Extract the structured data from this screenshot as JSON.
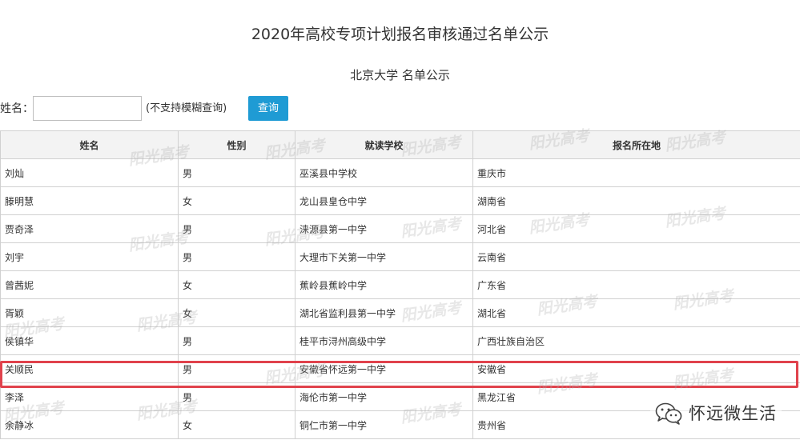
{
  "page": {
    "title": "2020年高校专项计划报名审核通过名单公示",
    "subtitle": "北京大学 名单公示"
  },
  "search": {
    "label": "姓名：",
    "value": "",
    "placeholder": "",
    "note": "(不支持模糊查询)",
    "button_label": "查询"
  },
  "table": {
    "headers": [
      "姓名",
      "性别",
      "就读学校",
      "报名所在地"
    ],
    "rows": [
      [
        "刘灿",
        "男",
        "巫溪县中学校",
        "重庆市"
      ],
      [
        "滕明慧",
        "女",
        "龙山县皇仓中学",
        "湖南省"
      ],
      [
        "贾奇泽",
        "男",
        "涞源县第一中学",
        "河北省"
      ],
      [
        "刘宇",
        "男",
        "大理市下关第一中学",
        "云南省"
      ],
      [
        "曾茜妮",
        "女",
        "蕉岭县蕉岭中学",
        "广东省"
      ],
      [
        "胥颖",
        "女",
        "湖北省监利县第一中学",
        "湖北省"
      ],
      [
        "侯镇华",
        "男",
        "桂平市浔州高级中学",
        "广西壮族自治区"
      ],
      [
        "关顺民",
        "男",
        "安徽省怀远第一中学",
        "安徽省"
      ],
      [
        "李泽",
        "男",
        "海伦市第一中学",
        "黑龙江省"
      ],
      [
        "余静冰",
        "女",
        "铜仁市第一中学",
        "贵州省"
      ]
    ],
    "highlighted_row": 7
  },
  "watermark": {
    "text": "阳光高考"
  },
  "brand": {
    "name": "怀远微生活",
    "icon": "wechat-icon"
  },
  "colors": {
    "button": "#1f9bd4",
    "highlight": "#e0424c",
    "header_bg": "#f3f3f3",
    "border": "#d0d0d0"
  }
}
